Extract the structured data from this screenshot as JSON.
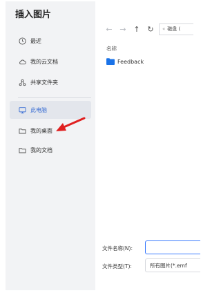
{
  "dialog": {
    "title": "插入图片"
  },
  "sidebar": {
    "items": [
      {
        "label": "最近",
        "icon": "clock-icon"
      },
      {
        "label": "我的云文档",
        "icon": "cloud-icon"
      },
      {
        "label": "共享文件夹",
        "icon": "share-icon"
      },
      {
        "label": "此电脑",
        "icon": "monitor-icon",
        "selected": true
      },
      {
        "label": "我的桌面",
        "icon": "folder-icon"
      },
      {
        "label": "我的文档",
        "icon": "folder-icon"
      }
    ]
  },
  "toolbar": {
    "back": "←",
    "forward": "→",
    "up": "↑",
    "refresh": "↻",
    "path_chevron": "«",
    "path_text": "磁盘 ("
  },
  "file_list": {
    "column_name": "名称",
    "items": [
      {
        "name": "Feedback",
        "type": "folder",
        "color": "#1a73e8"
      }
    ]
  },
  "form": {
    "filename_label": "文件名称(N):",
    "filename_value": "",
    "filetype_label": "文件类型(T):",
    "filetype_value": "所有图片(*.emf"
  },
  "colors": {
    "accent": "#3a7afe",
    "selected_text": "#3b6fd4",
    "annotation_arrow": "#e02020",
    "sidebar_bg": "#f2f3f5"
  }
}
